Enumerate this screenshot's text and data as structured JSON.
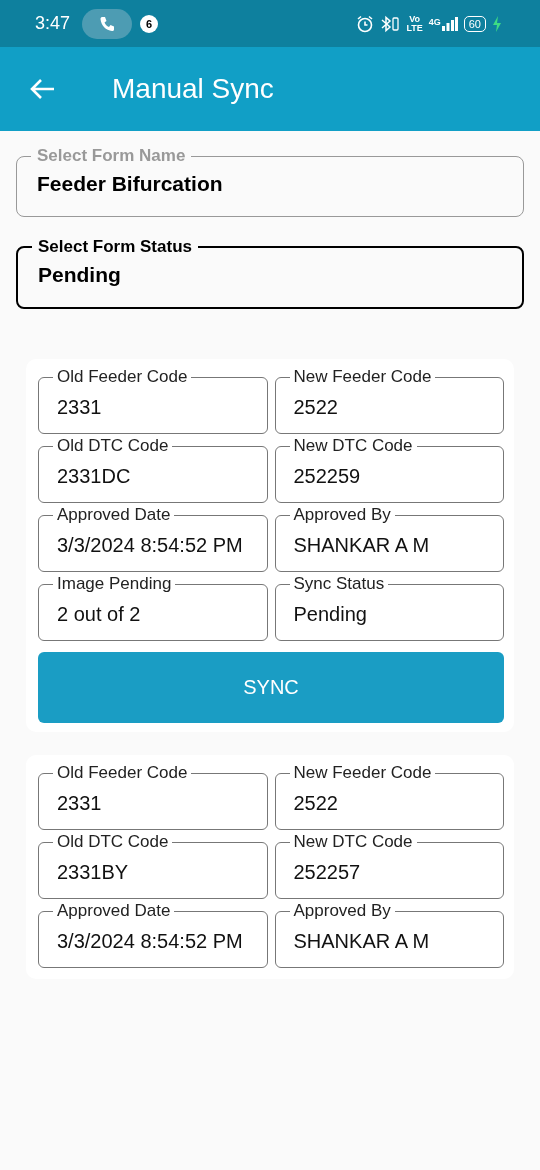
{
  "status_bar": {
    "time": "3:47",
    "call_badge": "6",
    "volte_top": "Vo",
    "volte_bottom": "LTE",
    "network": "4G",
    "battery": "60",
    "charging": true
  },
  "app_bar": {
    "title": "Manual Sync"
  },
  "form_name": {
    "label": "Select Form Name",
    "value": "Feeder Bifurcation",
    "focused": false
  },
  "form_status": {
    "label": "Select Form Status",
    "value": "Pending",
    "focused": true
  },
  "records": [
    {
      "fields": [
        {
          "label": "Old Feeder Code",
          "value": "2331"
        },
        {
          "label": "New Feeder Code",
          "value": "2522"
        },
        {
          "label": "Old DTC Code",
          "value": "2331DC"
        },
        {
          "label": "New DTC Code",
          "value": "252259"
        },
        {
          "label": "Approved Date",
          "value": "3/3/2024 8:54:52 PM"
        },
        {
          "label": "Approved By",
          "value": "SHANKAR A M"
        },
        {
          "label": "Image Pending",
          "value": "2 out of 2"
        },
        {
          "label": "Sync Status",
          "value": "Pending"
        }
      ],
      "button": "SYNC"
    },
    {
      "fields": [
        {
          "label": "Old Feeder Code",
          "value": "2331"
        },
        {
          "label": "New Feeder Code",
          "value": "2522"
        },
        {
          "label": "Old DTC Code",
          "value": "2331BY"
        },
        {
          "label": "New DTC Code",
          "value": "252257"
        },
        {
          "label": "Approved Date",
          "value": "3/3/2024 8:54:52 PM"
        },
        {
          "label": "Approved By",
          "value": "SHANKAR A M"
        }
      ]
    }
  ]
}
